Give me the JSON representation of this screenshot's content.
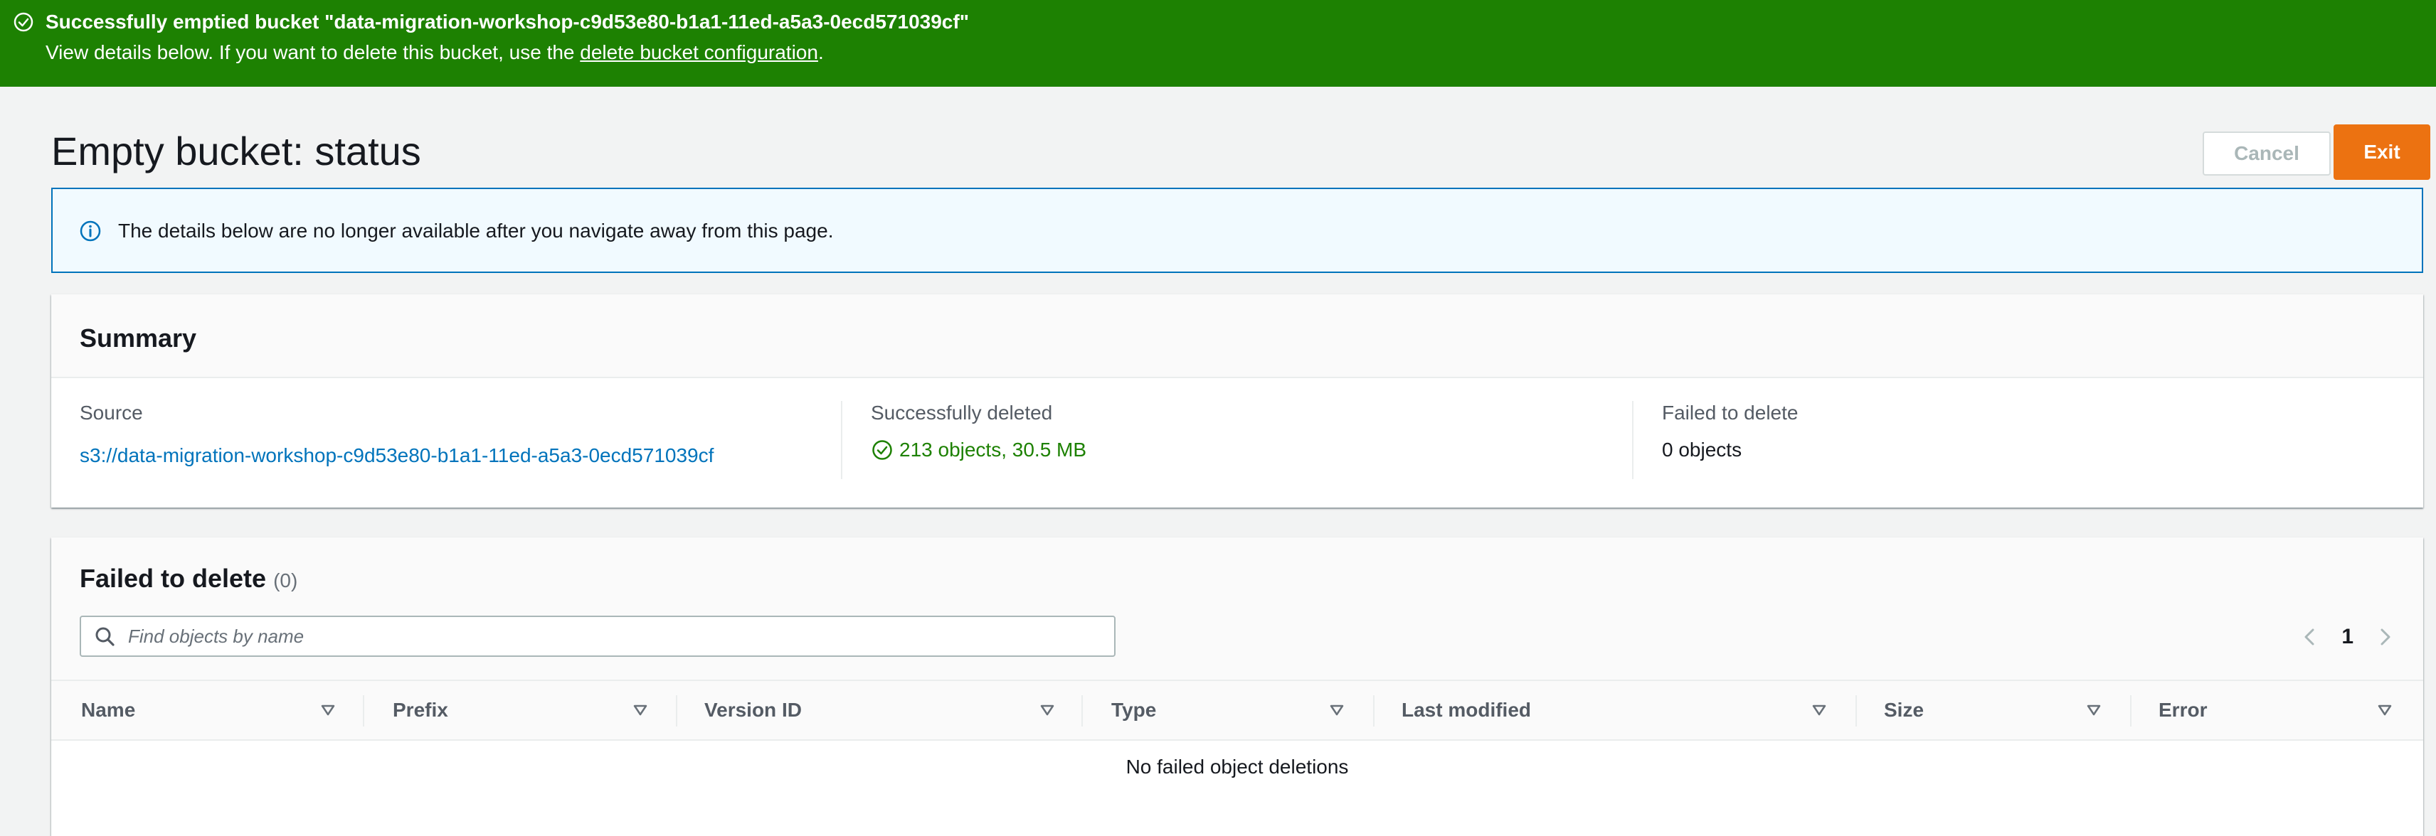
{
  "flash": {
    "title": "Successfully emptied bucket \"data-migration-workshop-c9d53e80-b1a1-11ed-a5a3-0ecd571039cf\"",
    "body_prefix": "View details below. If you want to delete this bucket, use the ",
    "body_link": "delete bucket configuration",
    "body_suffix": ".",
    "color": "#1d8102"
  },
  "header": {
    "title": "Empty bucket: status",
    "cancel_label": "Cancel",
    "exit_label": "Exit",
    "exit_color": "#ec7211"
  },
  "info": {
    "text": "The details below are no longer available after you navigate away from this page."
  },
  "summary": {
    "title": "Summary",
    "source_label": "Source",
    "source_value": "s3://data-migration-workshop-c9d53e80-b1a1-11ed-a5a3-0ecd571039cf",
    "deleted_label": "Successfully deleted",
    "deleted_value": "213 objects, 30.5 MB",
    "failed_label": "Failed to delete",
    "failed_value": "0 objects"
  },
  "failed_table": {
    "title": "Failed to delete",
    "count": "(0)",
    "search_placeholder": "Find objects by name",
    "page": "1",
    "columns": [
      "Name",
      "Prefix",
      "Version ID",
      "Type",
      "Last modified",
      "Size",
      "Error"
    ],
    "empty_text": "No failed object deletions"
  }
}
